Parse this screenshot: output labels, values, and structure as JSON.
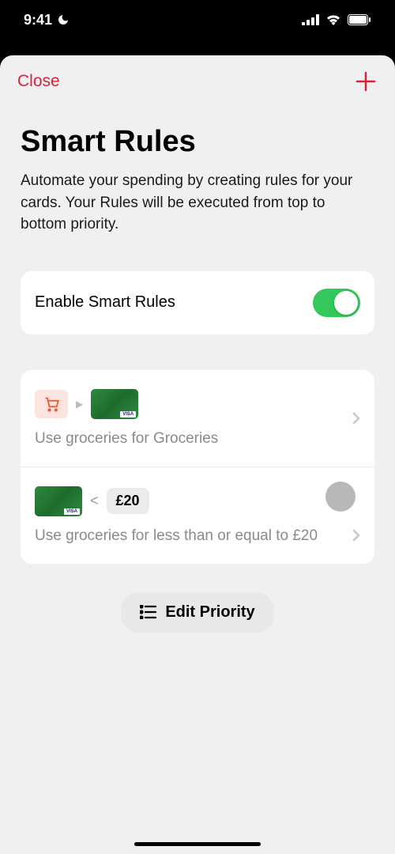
{
  "status": {
    "time": "9:41"
  },
  "header": {
    "close_label": "Close"
  },
  "page": {
    "title": "Smart Rules",
    "subtitle": "Automate your spending by creating rules for your cards. Your Rules will be executed from top to bottom priority."
  },
  "toggle": {
    "label": "Enable Smart Rules",
    "enabled": true
  },
  "rules": [
    {
      "description": "Use groceries for Groceries"
    },
    {
      "operator": "<",
      "amount": "£20",
      "description": "Use groceries for less than or equal to £20"
    }
  ],
  "edit_priority_label": "Edit Priority"
}
